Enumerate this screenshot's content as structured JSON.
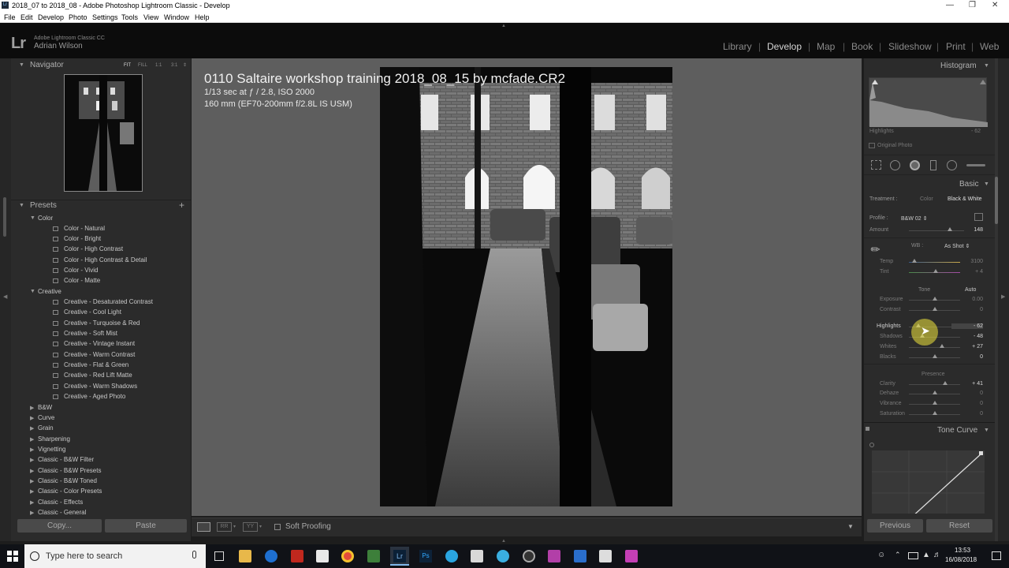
{
  "window": {
    "title": "2018_07 to 2018_08 - Adobe Photoshop Lightroom Classic - Develop",
    "menu": [
      "File",
      "Edit",
      "Develop",
      "Photo",
      "Settings",
      "Tools",
      "View",
      "Window",
      "Help"
    ]
  },
  "identity": {
    "logo": "Lr",
    "product": "Adobe Lightroom Classic CC",
    "user": "Adrian Wilson"
  },
  "modules": [
    "Library",
    "Develop",
    "Map",
    "Book",
    "Slideshow",
    "Print",
    "Web"
  ],
  "active_module": "Develop",
  "navigator": {
    "title": "Navigator",
    "zoom_options": [
      "FIT",
      "FILL",
      "1:1",
      "3:1"
    ]
  },
  "presets": {
    "title": "Presets",
    "add_symbol": "+",
    "color_group": {
      "name": "Color",
      "items": [
        "Color - Natural",
        "Color - Bright",
        "Color - High Contrast",
        "Color - High Contrast & Detail",
        "Color - Vivid",
        "Color - Matte"
      ]
    },
    "creative_group": {
      "name": "Creative",
      "items": [
        "Creative - Desaturated Contrast",
        "Creative - Cool Light",
        "Creative - Turquoise & Red",
        "Creative - Soft Mist",
        "Creative - Vintage Instant",
        "Creative - Warm Contrast",
        "Creative - Flat & Green",
        "Creative - Red Lift Matte",
        "Creative - Warm Shadows",
        "Creative - Aged Photo"
      ]
    },
    "collapsed_groups": [
      "B&W",
      "Curve",
      "Grain",
      "Sharpening",
      "Vignetting",
      "Classic - B&W Filter",
      "Classic - B&W Presets",
      "Classic - B&W Toned",
      "Classic - Color Presets",
      "Classic - Effects",
      "Classic - General"
    ]
  },
  "left_buttons": {
    "copy": "Copy...",
    "paste": "Paste"
  },
  "photo_info": {
    "filename": "0110 Saltaire workshop  training  2018_08_15 by mcfade.CR2",
    "exposure": "1/13 sec at ƒ / 2.8, ISO 2000",
    "lens": "160 mm (EF70-200mm f/2.8L IS USM)"
  },
  "toolbar": {
    "soft_proofing": "Soft Proofing"
  },
  "histogram": {
    "title": "Histogram",
    "hover_label": "Highlights",
    "hover_value": "- 62",
    "original_photo": "Original Photo"
  },
  "basic": {
    "title": "Basic",
    "treatment_label": "Treatment :",
    "treatment_color": "Color",
    "treatment_bw": "Black & White",
    "profile_label": "Profile :",
    "profile_value": "B&W 02",
    "amount_label": "Amount",
    "amount_value": "148",
    "amount_level": 0.74,
    "wb_label": "WB :",
    "wb_value": "As Shot",
    "tone_label": "Tone",
    "auto_label": "Auto",
    "presence_label": "Presence",
    "sliders": [
      {
        "label": "Temp",
        "value": "3100",
        "level": 0.1,
        "active": false
      },
      {
        "label": "Tint",
        "value": "+ 4",
        "level": 0.52,
        "active": false
      },
      {
        "label": "Exposure",
        "value": "0.00",
        "level": 0.5,
        "active": false
      },
      {
        "label": "Contrast",
        "value": "0",
        "level": 0.5,
        "active": false
      },
      {
        "label": "Highlights",
        "value": "- 62",
        "level": 0.19,
        "active": true
      },
      {
        "label": "Shadows",
        "value": "- 48",
        "level": 0.26,
        "active": true
      },
      {
        "label": "Whites",
        "value": "+ 27",
        "level": 0.64,
        "active": true
      },
      {
        "label": "Blacks",
        "value": "0",
        "level": 0.5,
        "active": true
      },
      {
        "label": "Clarity",
        "value": "+ 41",
        "level": 0.7,
        "active": true
      },
      {
        "label": "Dehaze",
        "value": "0",
        "level": 0.5,
        "active": false
      },
      {
        "label": "Vibrance",
        "value": "0",
        "level": 0.5,
        "active": false
      },
      {
        "label": "Saturation",
        "value": "0",
        "level": 0.5,
        "active": false
      }
    ]
  },
  "tone_curve": {
    "title": "Tone Curve"
  },
  "right_buttons": {
    "previous": "Previous",
    "reset": "Reset"
  },
  "taskbar": {
    "search_placeholder": "Type here to search",
    "time": "13:53",
    "date": "16/08/2018"
  }
}
